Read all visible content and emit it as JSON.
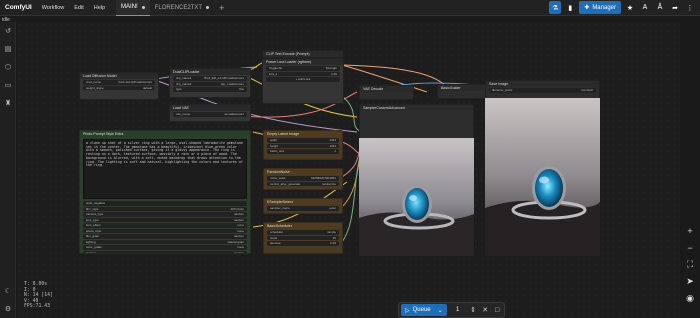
{
  "app": {
    "name": "ComfyUI"
  },
  "menu": [
    "Workflow",
    "Edit",
    "Help"
  ],
  "tabs": [
    {
      "label": "MAIN!",
      "active": true
    },
    {
      "label": "FLORENCE2TXT",
      "active": false
    }
  ],
  "toolbar": {
    "manager_label": "Manager"
  },
  "status": {
    "idle": "idle"
  },
  "stats": {
    "t": "T: 0.00s",
    "i": "I: 0",
    "n": "N: 14 [14]",
    "v": "V: 48",
    "fps": "FPS:71.43"
  },
  "queue": {
    "label": "Queue",
    "count": "1"
  },
  "nodes": {
    "load_diffusion": {
      "title": "Load Diffusion Model",
      "rows": [
        {
          "k": "unet_name",
          "v": "flux1-dev-fp8.safetensors"
        },
        {
          "k": "weight_dtype",
          "v": "default"
        }
      ]
    },
    "dual_clip": {
      "title": "DualCLIPLoader",
      "rows": [
        {
          "k": "clip_name1",
          "v": "t5xxl_fp8_e4m3fn.safetensors"
        },
        {
          "k": "clip_name2",
          "v": "clip_l.safetensors"
        },
        {
          "k": "type",
          "v": "flux"
        }
      ]
    },
    "load_vae": {
      "title": "Load VAE",
      "rows": [
        {
          "k": "vae_name",
          "v": "ae.safetensors"
        }
      ]
    },
    "power_lora": {
      "title": "Power Lora Loader (rgthree)",
      "rows": [
        {
          "k": "Toggle All",
          "v": "Strength"
        },
        {
          "k": "lora_1",
          "v": "1.00"
        }
      ],
      "add": "+ Add Lora"
    },
    "clip_text": {
      "title": "CLIP Text Encode (Prompt)"
    },
    "vae_decode": {
      "title": "VAE Decode"
    },
    "model_guider": {
      "title": "BasicGuider"
    },
    "sampler_custom": {
      "title": "SamplerCustomAdvanced"
    },
    "save_image": {
      "title": "Save Image",
      "rows": [
        {
          "k": "filename_prefix",
          "v": "ComfyUI"
        }
      ]
    },
    "prompt_node": {
      "title": "Photo Prompt Style Extra",
      "text": "a close up shot of a silver ring with a large, oval-shaped labradorite gemstone set in the center. The gemstone has a beautiful, iridescent blue-green color with a smooth, polished surface, giving it a glossy appearance. The ring is resting on a dark, textured surface, possibly a rock or a piece of wood. The background is blurred, with a soft, muted backdrop that draws attention to the ring. The lighting is soft and natural, highlighting the colors and textures of the ring.",
      "rows": [
        {
          "k": "style_negative",
          "v": ""
        },
        {
          "k": "film_style",
          "v": "100 photo"
        },
        {
          "k": "camera_type",
          "v": "random"
        },
        {
          "k": "lens_type",
          "v": "random"
        },
        {
          "k": "lens_effect",
          "v": "none"
        },
        {
          "k": "photo_style",
          "v": "none"
        },
        {
          "k": "film_grain",
          "v": "random"
        },
        {
          "k": "lighting",
          "v": "natural grain"
        },
        {
          "k": "color_grade",
          "v": "none"
        },
        {
          "k": "location",
          "v": "random"
        }
      ],
      "footer": "seed_id"
    },
    "empty_latent": {
      "title": "Empty Latent Image",
      "rows": [
        {
          "k": "width",
          "v": "1024"
        },
        {
          "k": "height",
          "v": "1024"
        },
        {
          "k": "batch_size",
          "v": "1"
        }
      ]
    },
    "random_noise": {
      "title": "RandomNoise",
      "rows": [
        {
          "k": "noise_seed",
          "v": "640569207901901"
        },
        {
          "k": "control_after_generate",
          "v": "randomize"
        }
      ]
    },
    "ksampler_select": {
      "title": "KSamplerSelect",
      "rows": [
        {
          "k": "sampler_name",
          "v": "euler"
        }
      ]
    },
    "basic_scheduler": {
      "title": "BasicScheduler",
      "rows": [
        {
          "k": "scheduler",
          "v": "simple"
        },
        {
          "k": "steps",
          "v": "20"
        },
        {
          "k": "denoise",
          "v": "1.00"
        }
      ]
    }
  }
}
